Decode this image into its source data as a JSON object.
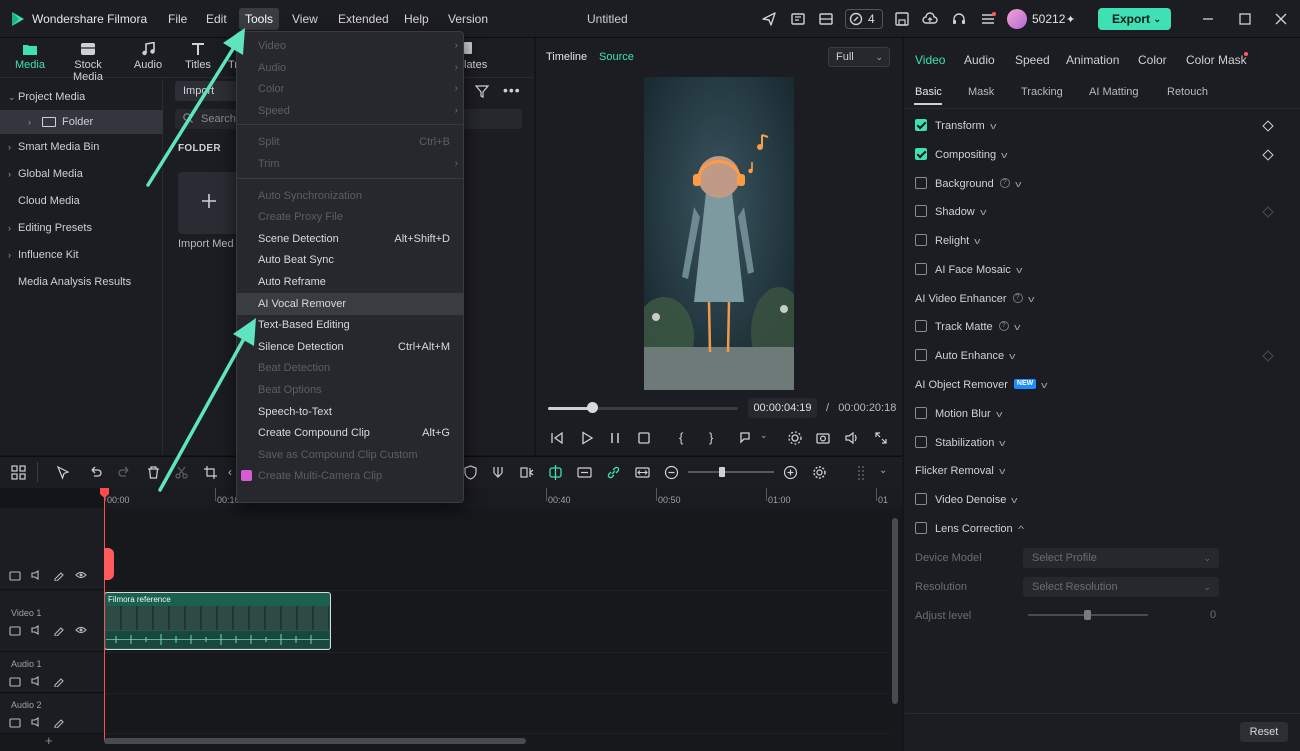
{
  "app": {
    "title": "Wondershare Filmora",
    "doc_title": "Untitled"
  },
  "menu": {
    "file": "File",
    "edit": "Edit",
    "tools": "Tools",
    "view": "View",
    "extended": "Extended",
    "help": "Help",
    "version": "Version"
  },
  "topbar": {
    "counter": "4",
    "credits": "50212",
    "export": "Export"
  },
  "media_tabs": {
    "media": "Media",
    "stock_media": "Stock Media",
    "audio": "Audio",
    "titles": "Titles",
    "partial_tr": "Tr",
    "partial_templates": "lates"
  },
  "sidebar": {
    "items": [
      {
        "label": "Project Media",
        "caret": "⌄"
      },
      {
        "label": "Folder",
        "caret": "›"
      },
      {
        "label": "Smart Media Bin",
        "caret": "›"
      },
      {
        "label": "Global Media",
        "caret": "›"
      },
      {
        "label": "Cloud Media",
        "caret": ""
      },
      {
        "label": "Editing Presets",
        "caret": "›"
      },
      {
        "label": "Influence Kit",
        "caret": "›"
      },
      {
        "label": "Media Analysis Results",
        "caret": ""
      }
    ]
  },
  "library": {
    "import": "Import",
    "search_placeholder": "Search",
    "folder_label": "FOLDER",
    "import_media": "Import Med"
  },
  "player": {
    "timeline_tab": "Timeline",
    "source_tab": "Source",
    "quality": "Full",
    "current_time": "00:00:04:19",
    "separator": "/",
    "total_time": "00:00:20:18",
    "progress": 0.23
  },
  "dropdown": {
    "groups": [
      [
        {
          "label": "Video",
          "disabled": true,
          "submenu": true
        },
        {
          "label": "Audio",
          "disabled": true,
          "submenu": true
        },
        {
          "label": "Color",
          "disabled": true,
          "submenu": true
        },
        {
          "label": "Speed",
          "disabled": true,
          "submenu": true
        }
      ],
      [
        {
          "label": "Split",
          "shortcut": "Ctrl+B",
          "disabled": true
        },
        {
          "label": "Trim",
          "disabled": true,
          "submenu": true
        }
      ],
      [
        {
          "label": "Auto Synchronization",
          "disabled": true
        },
        {
          "label": "Create Proxy File",
          "disabled": true
        },
        {
          "label": "Scene Detection",
          "shortcut": "Alt+Shift+D"
        },
        {
          "label": "Auto Beat Sync"
        },
        {
          "label": "Auto Reframe"
        },
        {
          "label": "AI Vocal Remover",
          "hover": true
        },
        {
          "label": "Text-Based Editing"
        },
        {
          "label": "Silence Detection",
          "shortcut": "Ctrl+Alt+M"
        },
        {
          "label": "Beat Detection",
          "disabled": true
        },
        {
          "label": "Beat Options",
          "disabled": true
        },
        {
          "label": "Speech-to-Text"
        },
        {
          "label": "Create Compound Clip",
          "shortcut": "Alt+G"
        },
        {
          "label": "Save as Compound Clip Custom",
          "disabled": true
        },
        {
          "label": "Create Multi-Camera Clip",
          "disabled": true,
          "icon": true
        }
      ]
    ]
  },
  "right_panel": {
    "tabs": [
      "Video",
      "Audio",
      "Speed",
      "Animation",
      "Color",
      "Color Mask"
    ],
    "subtabs": [
      "Basic",
      "Mask",
      "Tracking",
      "AI Matting",
      "Retouch"
    ],
    "rows": [
      {
        "label": "Transform",
        "checkbox": true,
        "checked": true,
        "keyframe": "on"
      },
      {
        "label": "Compositing",
        "checkbox": true,
        "checked": true,
        "keyframe": "on"
      },
      {
        "label": "Background",
        "checkbox": true,
        "help": true
      },
      {
        "label": "Shadow",
        "checkbox": true,
        "keyframe": "dim"
      },
      {
        "label": "Relight",
        "checkbox": true
      },
      {
        "label": "AI Face Mosaic",
        "checkbox": true
      },
      {
        "label": "AI Video Enhancer",
        "checkbox": false,
        "help": true
      },
      {
        "label": "Track Matte",
        "checkbox": true,
        "help": true
      },
      {
        "label": "Auto Enhance",
        "checkbox": true,
        "keyframe": "dim"
      },
      {
        "label": "AI Object Remover",
        "checkbox": false,
        "badge": "NEW"
      },
      {
        "label": "Motion Blur",
        "checkbox": true
      },
      {
        "label": "Stabilization",
        "checkbox": true
      },
      {
        "label": "Flicker Removal",
        "checkbox": false
      },
      {
        "label": "Video Denoise",
        "checkbox": true
      },
      {
        "label": "Lens Correction",
        "checkbox": true,
        "expanded": true
      }
    ],
    "device_model_label": "Device Model",
    "device_model_value": "Select Profile",
    "resolution_label": "Resolution",
    "resolution_value": "Select Resolution",
    "adjust_label": "Adjust level",
    "adjust_value": "0",
    "reset": "Reset"
  },
  "timeline": {
    "ruler": [
      "00:00",
      "00:10",
      "00:40",
      "00:50",
      "01:00",
      "01"
    ],
    "tracks": [
      {
        "name": ""
      },
      {
        "name": "Video 1"
      },
      {
        "name": "Audio 1"
      },
      {
        "name": "Audio 2"
      }
    ],
    "clip_title": "Filmora reference",
    "add_track": "+"
  },
  "colors": {
    "accent": "#3ee0b4",
    "playhead": "#ff4b4b",
    "annotation_arrow": "#5ee5c0"
  }
}
